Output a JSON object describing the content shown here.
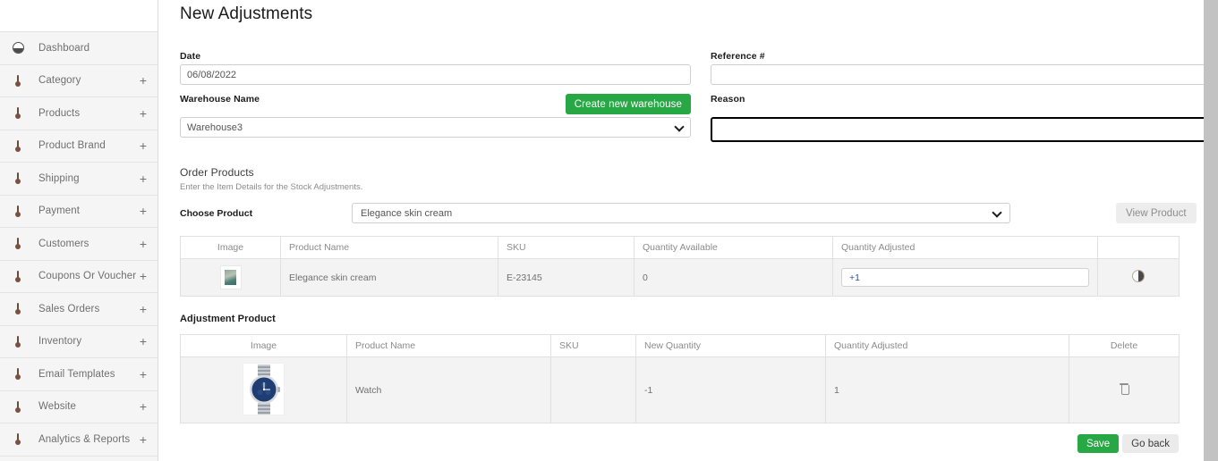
{
  "sidebar": {
    "items": [
      {
        "label": "Dashboard",
        "icon": "dashboard-icon",
        "expandable": false
      },
      {
        "label": "Category",
        "icon": "thermometer-icon",
        "expandable": true,
        "expand": "+"
      },
      {
        "label": "Products",
        "icon": "thermometer-icon",
        "expandable": true,
        "expand": "+"
      },
      {
        "label": "Product Brand",
        "icon": "thermometer-icon",
        "expandable": true,
        "expand": "+"
      },
      {
        "label": "Shipping",
        "icon": "thermometer-icon",
        "expandable": true,
        "expand": "+"
      },
      {
        "label": "Payment",
        "icon": "thermometer-icon",
        "expandable": true,
        "expand": "+"
      },
      {
        "label": "Customers",
        "icon": "thermometer-icon",
        "expandable": true,
        "expand": "+"
      },
      {
        "label": "Coupons Or Voucher",
        "icon": "thermometer-icon",
        "expandable": true,
        "expand": "+"
      },
      {
        "label": "Sales Orders",
        "icon": "thermometer-icon",
        "expandable": true,
        "expand": "+"
      },
      {
        "label": "Inventory",
        "icon": "thermometer-icon",
        "expandable": true,
        "expand": "+"
      },
      {
        "label": "Email Templates",
        "icon": "thermometer-icon",
        "expandable": true,
        "expand": "+"
      },
      {
        "label": "Website",
        "icon": "thermometer-icon",
        "expandable": true,
        "expand": "+"
      },
      {
        "label": "Analytics & Reports",
        "icon": "thermometer-icon",
        "expandable": true,
        "expand": "+"
      }
    ]
  },
  "page": {
    "title": "New Adjustments"
  },
  "form": {
    "date": {
      "label": "Date",
      "value": "06/08/2022",
      "placeholder": ""
    },
    "reference": {
      "label": "Reference #",
      "value": "",
      "placeholder": ""
    },
    "warehouse": {
      "label": "Warehouse Name",
      "selected": "Warehouse3",
      "options": [
        "Warehouse3"
      ]
    },
    "create_warehouse_button": "Create new warehouse",
    "reason": {
      "label": "Reason",
      "value": "",
      "placeholder": ""
    }
  },
  "order_products": {
    "title": "Order Products",
    "subtitle": "Enter the Item Details for the Stock Adjustments.",
    "choose_product_label": "Choose Product",
    "choose_product_selected": "Elegance skin cream",
    "choose_product_options": [
      "Elegance skin cream"
    ],
    "view_product_button": "View Product",
    "table": {
      "columns": [
        "Image",
        "Product Name",
        "SKU",
        "Quantity Available",
        "Quantity Adjusted",
        ""
      ],
      "rows": [
        {
          "image": "product-thumbnail-skin-cream",
          "product_name": "Elegance skin cream",
          "sku": "E-23145",
          "quantity_available": "0",
          "quantity_adjusted": "+1",
          "action_icon": "half-circle-icon"
        }
      ]
    }
  },
  "adjustment_product": {
    "title": "Adjustment Product",
    "table": {
      "columns": [
        "Image",
        "Product Name",
        "SKU",
        "New Quantity",
        "Quantity Adjusted",
        "Delete"
      ],
      "rows": [
        {
          "image": "product-thumbnail-watch",
          "product_name": "Watch",
          "sku": "",
          "new_quantity": "-1",
          "quantity_adjusted": "1",
          "delete_icon": "trash-icon"
        }
      ]
    }
  },
  "footer": {
    "save_label": "Save",
    "goback_label": "Go back"
  },
  "colors": {
    "brand_green": "#28a745",
    "sidebar_bg": "#f5f5f5",
    "table_row_bg": "#f3f3f3",
    "focus_border": "#000000"
  }
}
